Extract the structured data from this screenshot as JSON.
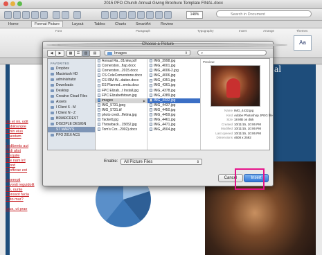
{
  "window": {
    "title": "2015 PFO Church Annual Giving Brochure Template FINAL.docx",
    "zoom": "148%",
    "search_placeholder": "Search in Document"
  },
  "ribbon": {
    "tabs": [
      "Home",
      "Format Picture",
      "Layout",
      "Tables",
      "Charts",
      "SmartArt",
      "Review"
    ],
    "active_tab": "Format Picture",
    "groups": [
      "Font",
      "Paragraph",
      "Typography",
      "Insert",
      "Arrange",
      "Themes"
    ]
  },
  "document": {
    "banner_text": "al",
    "left_links": [
      "olo et mi. odit",
      "...ubilosnpre",
      "a min eius",
      "...aestum",
      "",
      "nedibnnts aut",
      "audi aliat",
      "ausquile",
      "que nam int",
      "... ord",
      "et officae est",
      "",
      "reserepti",
      "... vonti reguidolit",
      "om, ounte",
      "monssot facia",
      "iusto mur?",
      "",
      "laius, ut prae"
    ]
  },
  "dialog": {
    "title": "Choose a Picture",
    "location": "Images",
    "search_placeholder": "",
    "sidebar": {
      "heading": "FAVORITES",
      "items": [
        "Dropbox",
        "Macintosh HD",
        "administrator",
        "Downloads",
        "Desktop",
        "Creative Cloud Files",
        "Assets",
        "I Client 6 - M",
        "I Client N - Z",
        "BRIARCREST",
        "DISCIPLE DESIGN",
        "ST MARY'S",
        "PFO 2016 ACS"
      ],
      "selected_index": 11
    },
    "column1": {
      "items": [
        "Annual Ra...01nkw.pdf",
        "Cornerston...flap.docx",
        "Cornerston...2015.docx",
        "CS ColeCornerstone.docx",
        "CS IRM W...dation.docx",
        "ES Planned...ernia.docx",
        "FPC Elizab...t Install.jpg",
        "FPC Elizabethtown.jpg",
        "images",
        "IMG_5731.jpeg",
        "IMG_5731.tif",
        "photo credi...ffetina.jpg",
        "Tackett.jpg",
        "Throwback...15652.jpg",
        "Tom's Cor...2002).docx"
      ],
      "selected_index": 8
    },
    "column2": {
      "items": [
        "IMG_3998.jpg",
        "IMG_4001.jpg",
        "IMG_4006-2.jpg",
        "IMG_4006.jpg",
        "IMG_4351.jpg",
        "IMG_4361.jpg",
        "IMG_4378.jpg",
        "IMG_4389.jpg",
        "IMG_4432.jpg",
        "IMG_4437.jpg",
        "IMG_4450.jpg",
        "IMG_4459.jpg",
        "IMG_4461.jpg",
        "IMG_4471.jpg",
        "IMG_4504.jpg"
      ],
      "selected_index": 8
    },
    "preview": {
      "label": "Preview:",
      "meta": [
        {
          "k": "Name",
          "v": "IMG_4432.jpg"
        },
        {
          "k": "Kind",
          "v": "Adobe Photoshop JPEG file"
        },
        {
          "k": "Size",
          "v": "18 MB on disk"
        },
        {
          "k": "Created",
          "v": "10/11/15, 10:06 PM"
        },
        {
          "k": "Modified",
          "v": "10/11/15, 10:06 PM"
        },
        {
          "k": "Last opened",
          "v": "10/11/15, 10:06 PM"
        },
        {
          "k": "Dimensions",
          "v": "4608 x 2592"
        }
      ]
    },
    "enable_label": "Enable:",
    "enable_value": "All Picture Files",
    "cancel_label": "Cancel",
    "insert_label": "Insert"
  },
  "colors": {
    "highlight": "#e6138a",
    "accent_blue": "#1e4d7b",
    "selection": "#3b6fc5"
  }
}
